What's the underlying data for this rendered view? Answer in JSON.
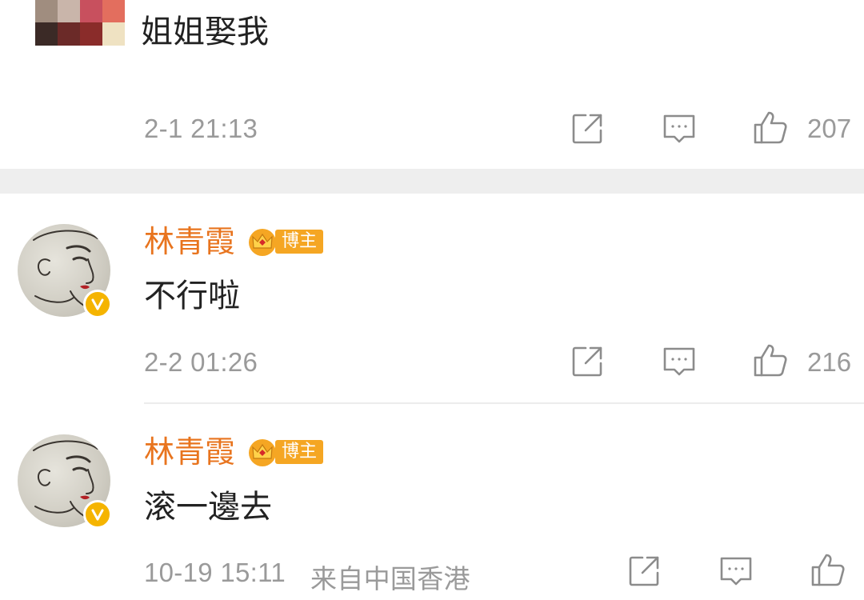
{
  "comments": [
    {
      "text": "姐姐娶我",
      "time": "2-1 21:13",
      "like_count": "207"
    },
    {
      "name": "林青霞",
      "badge": "博主",
      "text": "不行啦",
      "time": "2-2 01:26",
      "like_count": "216"
    },
    {
      "name": "林青霞",
      "badge": "博主",
      "text": "滚一邊去",
      "time": "10-19 15:11",
      "location": "来自中国香港"
    }
  ],
  "icons": {
    "share": "share-icon",
    "comment": "comment-icon",
    "like": "thumbs-up-icon",
    "verified": "verified-v-icon",
    "crown": "crown-icon"
  },
  "colors": {
    "name": "#e8741e",
    "badge": "#f5a623",
    "verified": "#f5b400",
    "meta": "#9a9a9a",
    "text": "#222222",
    "separator": "#eeeeee"
  }
}
